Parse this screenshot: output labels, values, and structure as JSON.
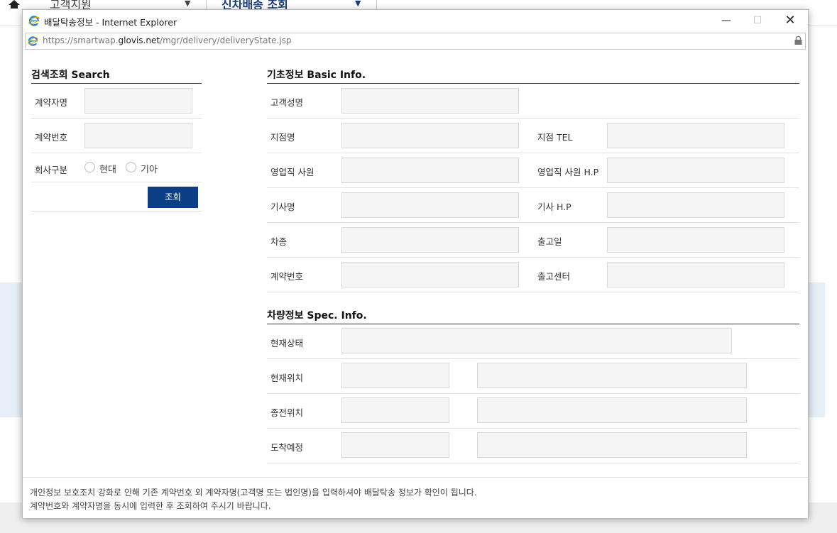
{
  "background": {
    "nav_left": "고객지원",
    "nav_right": "신차배송 조회"
  },
  "window": {
    "title": "배달탁송정보 - Internet Explorer",
    "url_prefix": "https://smartwap.",
    "url_domain": "glovis.net",
    "url_path": "/mgr/delivery/deliveryState.jsp",
    "minimize": "—",
    "maximize": "☐",
    "close": "✕"
  },
  "search": {
    "title": "검색조회 Search",
    "contract_name_label": "계약자명",
    "contract_no_label": "계약번호",
    "company_label": "회사구분",
    "company_options": [
      "현대",
      "기아"
    ],
    "search_button": "조회"
  },
  "basic_info": {
    "title": "기초정보 Basic Info.",
    "customer_name": "고객성명",
    "branch_name": "지점명",
    "branch_tel": "지점 TEL",
    "sales_staff": "영업직 사원",
    "sales_staff_hp": "영업직 사원 H.P",
    "driver_name": "기사명",
    "driver_hp": "기사 H.P",
    "car_model": "차종",
    "release_date": "출고일",
    "contract_no": "계약번호",
    "release_center": "출고센터"
  },
  "spec_info": {
    "title": "차량정보 Spec. Info.",
    "current_status": "현재상태",
    "current_location": "현재위치",
    "previous_location": "종전위치",
    "expected_arrival": "도착예정"
  },
  "footer": {
    "line1": "개인정보 보호조치 강화로 인해 기존 계약번호 외 계약자명(고객명 또는 법인명)을 입력하셔야 배달탁송 정보가 확인이 됩니다.",
    "line2": "계약번호와 계약자명을 동시에 입력한 후 조회하여 주시기 바랍니다."
  },
  "colors": {
    "accent": "#0a3f86",
    "field_bg": "#f5f5f5"
  }
}
